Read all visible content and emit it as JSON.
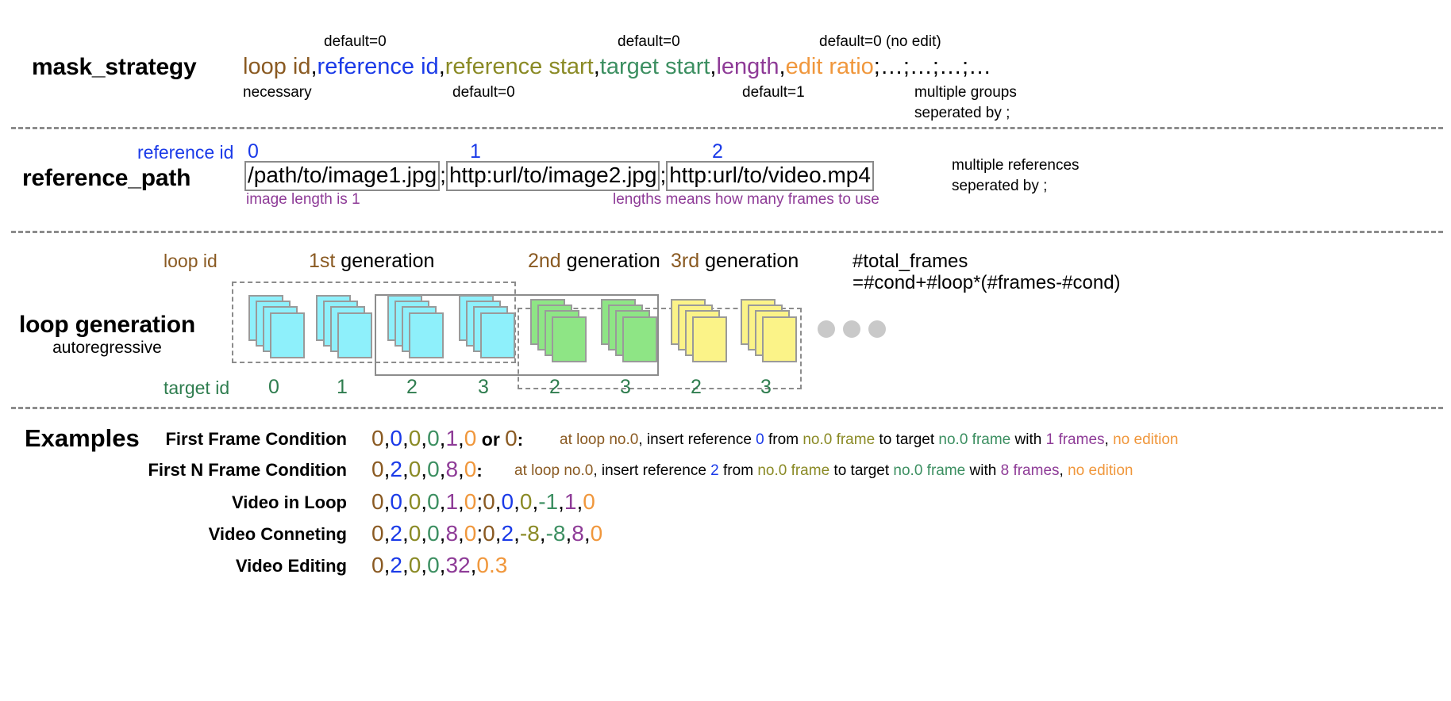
{
  "rows": {
    "mask_strategy": {
      "label": "mask_strategy",
      "fields": [
        {
          "text": "loop id",
          "color": "loop"
        },
        {
          "text": "reference id",
          "color": "ref"
        },
        {
          "text": "reference start",
          "color": "refst"
        },
        {
          "text": "target start",
          "color": "tgt"
        },
        {
          "text": "length",
          "color": "len"
        },
        {
          "text": "edit ratio",
          "color": "edit"
        }
      ],
      "tail": ";…;…;…;…",
      "notes_above": [
        {
          "text": "default=0"
        },
        {
          "text": "default=0"
        },
        {
          "text": "default=0 (no edit)"
        }
      ],
      "notes_below": [
        {
          "text": "necessary"
        },
        {
          "text": "default=0"
        },
        {
          "text": "default=1"
        },
        {
          "text": "multiple groups"
        },
        {
          "text": "seperated by ;"
        }
      ]
    },
    "reference_path": {
      "label": "reference_path",
      "id_caption": "reference id",
      "ids": [
        "0",
        "1",
        "2"
      ],
      "paths": [
        "/path/to/image1.jpg",
        "http:url/to/image2.jpg",
        "http:url/to/video.mp4"
      ],
      "separator": ";",
      "note_left": "image length is 1",
      "note_right": "lengths means how many frames to use",
      "side_note_line1": "multiple references",
      "side_note_line2": "seperated by ;"
    },
    "loop_generation": {
      "label": "loop generation",
      "sublabel": "autoregressive",
      "loop_id_caption": "loop id",
      "target_id_caption": "target id",
      "generations": [
        "1st generation",
        "2nd generation",
        "3rd generation"
      ],
      "formula_line1": "#total_frames",
      "formula_line2": "=#cond+#loop*(#frames-#cond)",
      "target_ids": [
        "0",
        "1",
        "2",
        "3",
        "2",
        "3",
        "2",
        "3"
      ],
      "stack_colors": [
        "cy",
        "cy",
        "cy",
        "cy",
        "gr",
        "gr",
        "yl",
        "yl"
      ]
    },
    "examples": {
      "title": "Examples",
      "items": [
        {
          "name": "First Frame Condition",
          "code": [
            {
              "t": "0",
              "c": "loop"
            },
            {
              "t": ",",
              "c": "black"
            },
            {
              "t": "0",
              "c": "ref"
            },
            {
              "t": ",",
              "c": "black"
            },
            {
              "t": "0",
              "c": "refst"
            },
            {
              "t": ",",
              "c": "black"
            },
            {
              "t": "0",
              "c": "tgt"
            },
            {
              "t": ",",
              "c": "black"
            },
            {
              "t": "1",
              "c": "len"
            },
            {
              "t": ",",
              "c": "black"
            },
            {
              "t": "0",
              "c": "edit"
            }
          ],
          "or_text": "or",
          "or_code": [
            {
              "t": "0",
              "c": "loop"
            }
          ],
          "colon": ":",
          "desc": [
            {
              "t": "at loop ",
              "c": "loop"
            },
            {
              "t": "no.0",
              "c": "loop"
            },
            {
              "t": ", ",
              "c": "black"
            },
            {
              "t": "insert reference ",
              "c": "black"
            },
            {
              "t": "0",
              "c": "ref"
            },
            {
              "t": " from ",
              "c": "black"
            },
            {
              "t": "no.0 frame",
              "c": "refst"
            },
            {
              "t": " to target ",
              "c": "black"
            },
            {
              "t": "no.0 frame",
              "c": "tgt"
            },
            {
              "t": " with ",
              "c": "black"
            },
            {
              "t": "1 frames",
              "c": "len"
            },
            {
              "t": ", ",
              "c": "black"
            },
            {
              "t": "no edition",
              "c": "edit"
            }
          ]
        },
        {
          "name": "First N Frame Condition",
          "code": [
            {
              "t": "0",
              "c": "loop"
            },
            {
              "t": ",",
              "c": "black"
            },
            {
              "t": "2",
              "c": "ref"
            },
            {
              "t": ",",
              "c": "black"
            },
            {
              "t": "0",
              "c": "refst"
            },
            {
              "t": ",",
              "c": "black"
            },
            {
              "t": "0",
              "c": "tgt"
            },
            {
              "t": ",",
              "c": "black"
            },
            {
              "t": "8",
              "c": "len"
            },
            {
              "t": ",",
              "c": "black"
            },
            {
              "t": "0",
              "c": "edit"
            }
          ],
          "or_text": "",
          "or_code": [],
          "colon": ":",
          "desc": [
            {
              "t": "at loop ",
              "c": "loop"
            },
            {
              "t": "no.0",
              "c": "loop"
            },
            {
              "t": ", ",
              "c": "black"
            },
            {
              "t": "insert reference ",
              "c": "black"
            },
            {
              "t": "2",
              "c": "ref"
            },
            {
              "t": " from ",
              "c": "black"
            },
            {
              "t": "no.0 frame",
              "c": "refst"
            },
            {
              "t": " to target ",
              "c": "black"
            },
            {
              "t": "no.0 frame",
              "c": "tgt"
            },
            {
              "t": " with ",
              "c": "black"
            },
            {
              "t": "8 frames",
              "c": "len"
            },
            {
              "t": ", ",
              "c": "black"
            },
            {
              "t": "no edition",
              "c": "edit"
            }
          ]
        },
        {
          "name": "Video in Loop",
          "code": [
            {
              "t": "0",
              "c": "loop"
            },
            {
              "t": ",",
              "c": "black"
            },
            {
              "t": "0",
              "c": "ref"
            },
            {
              "t": ",",
              "c": "black"
            },
            {
              "t": "0",
              "c": "refst"
            },
            {
              "t": ",",
              "c": "black"
            },
            {
              "t": "0",
              "c": "tgt"
            },
            {
              "t": ",",
              "c": "black"
            },
            {
              "t": "1",
              "c": "len"
            },
            {
              "t": ",",
              "c": "black"
            },
            {
              "t": "0",
              "c": "edit"
            },
            {
              "t": ";",
              "c": "black"
            },
            {
              "t": "0",
              "c": "loop"
            },
            {
              "t": ",",
              "c": "black"
            },
            {
              "t": "0",
              "c": "ref"
            },
            {
              "t": ",",
              "c": "black"
            },
            {
              "t": "0",
              "c": "refst"
            },
            {
              "t": ",",
              "c": "black"
            },
            {
              "t": "-1",
              "c": "tgt"
            },
            {
              "t": ",",
              "c": "black"
            },
            {
              "t": "1",
              "c": "len"
            },
            {
              "t": ",",
              "c": "black"
            },
            {
              "t": "0",
              "c": "edit"
            }
          ],
          "or_text": "",
          "or_code": [],
          "colon": "",
          "desc": []
        },
        {
          "name": "Video Conneting",
          "code": [
            {
              "t": "0",
              "c": "loop"
            },
            {
              "t": ",",
              "c": "black"
            },
            {
              "t": "2",
              "c": "ref"
            },
            {
              "t": ",",
              "c": "black"
            },
            {
              "t": "0",
              "c": "refst"
            },
            {
              "t": ",",
              "c": "black"
            },
            {
              "t": "0",
              "c": "tgt"
            },
            {
              "t": ",",
              "c": "black"
            },
            {
              "t": "8",
              "c": "len"
            },
            {
              "t": ",",
              "c": "black"
            },
            {
              "t": "0",
              "c": "edit"
            },
            {
              "t": ";",
              "c": "black"
            },
            {
              "t": "0",
              "c": "loop"
            },
            {
              "t": ",",
              "c": "black"
            },
            {
              "t": "2",
              "c": "ref"
            },
            {
              "t": ",",
              "c": "black"
            },
            {
              "t": "-8",
              "c": "refst"
            },
            {
              "t": ",",
              "c": "black"
            },
            {
              "t": "-8",
              "c": "tgt"
            },
            {
              "t": ",",
              "c": "black"
            },
            {
              "t": "8",
              "c": "len"
            },
            {
              "t": ",",
              "c": "black"
            },
            {
              "t": "0",
              "c": "edit"
            }
          ],
          "or_text": "",
          "or_code": [],
          "colon": "",
          "desc": []
        },
        {
          "name": "Video Editing",
          "code": [
            {
              "t": "0",
              "c": "loop"
            },
            {
              "t": ",",
              "c": "black"
            },
            {
              "t": "2",
              "c": "ref"
            },
            {
              "t": ",",
              "c": "black"
            },
            {
              "t": "0",
              "c": "refst"
            },
            {
              "t": ",",
              "c": "black"
            },
            {
              "t": "0",
              "c": "tgt"
            },
            {
              "t": ",",
              "c": "black"
            },
            {
              "t": "32",
              "c": "len"
            },
            {
              "t": ",",
              "c": "black"
            },
            {
              "t": "0.3",
              "c": "edit"
            }
          ],
          "or_text": "",
          "or_code": [],
          "colon": "",
          "desc": []
        }
      ]
    }
  },
  "colors": {
    "loop": "#8a5a22",
    "ref": "#1a3ae8",
    "refst": "#8a8a25",
    "tgt": "#3c8f61",
    "len": "#8e3b97",
    "edit": "#f0973c",
    "black": "#000000",
    "purple_note": "#8e3b97",
    "frame_cyan": "#8ef0fb",
    "frame_green": "#8ee585",
    "frame_yellow": "#fbf388",
    "border_gray": "#8c8c8c"
  }
}
